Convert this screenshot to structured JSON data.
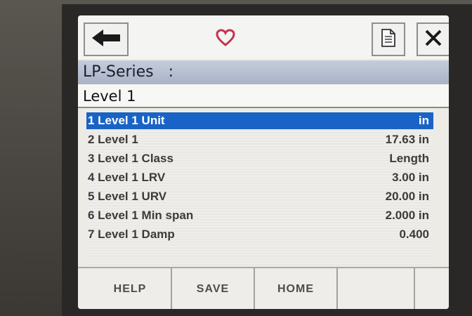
{
  "toolbar": {
    "back_icon": "arrow-left-icon",
    "favorite_icon": "heart-icon",
    "document_icon": "document-icon",
    "close_icon": "close-icon",
    "favorite_color": "#c0344d"
  },
  "header": {
    "device": "LP-Series   :",
    "page_title": "Level 1"
  },
  "list": {
    "items": [
      {
        "label": "1 Level 1 Unit",
        "value": "in"
      },
      {
        "label": "2 Level 1",
        "value": "17.63 in"
      },
      {
        "label": "3 Level 1 Class",
        "value": "Length"
      },
      {
        "label": "4 Level 1 LRV",
        "value": "3.00 in"
      },
      {
        "label": "5 Level 1 URV",
        "value": "20.00 in"
      },
      {
        "label": "6 Level 1 Min span",
        "value": "2.000 in"
      },
      {
        "label": "7 Level 1 Damp",
        "value": "0.400"
      }
    ],
    "selected_index": 0,
    "selected_color": "#1a63c6"
  },
  "buttons": {
    "help": "HELP",
    "save": "SAVE",
    "home": "HOME",
    "empty": ""
  }
}
